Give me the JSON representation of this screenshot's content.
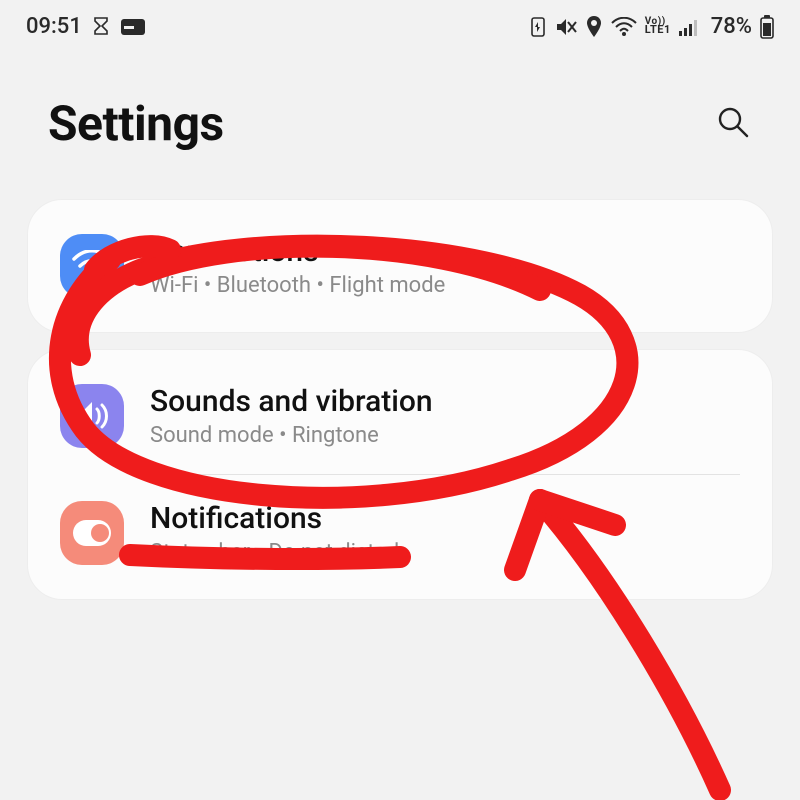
{
  "status_bar": {
    "time": "09:51",
    "battery_pct": "78%",
    "lte_top": "Vo))",
    "lte_bottom": "LTE1"
  },
  "header": {
    "title": "Settings"
  },
  "items": {
    "connections": {
      "title": "Connections",
      "sub": "Wi-Fi  •  Bluetooth  •  Flight mode"
    },
    "sounds": {
      "title": "Sounds and vibration",
      "sub": "Sound mode  •  Ringtone"
    },
    "notifications": {
      "title": "Notifications",
      "sub": "Status bar  •  Do not disturb"
    }
  }
}
